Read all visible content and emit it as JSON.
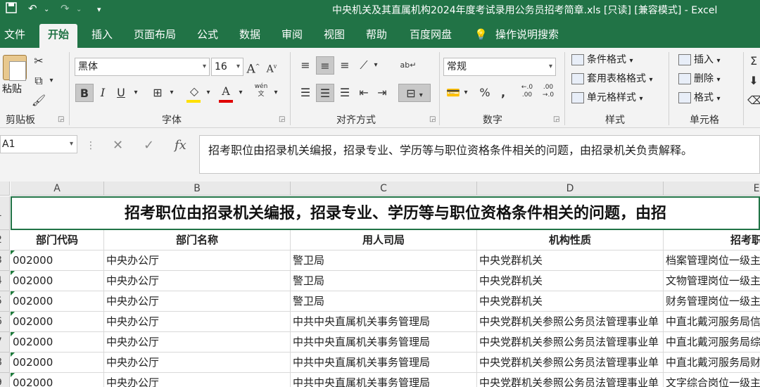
{
  "titlebar": {
    "title": "中央机关及其直属机构2024年度考试录用公务员招考简章.xls  [只读]  [兼容模式]  -  Excel",
    "save_icon": "save-icon",
    "undo_icon": "undo-icon",
    "redo_icon": "redo-icon"
  },
  "tabs": [
    "文件",
    "开始",
    "插入",
    "页面布局",
    "公式",
    "数据",
    "审阅",
    "视图",
    "帮助",
    "百度网盘",
    "操作说明搜索"
  ],
  "ribbon": {
    "clipboard": {
      "paste": "粘贴",
      "label": "剪贴板"
    },
    "font": {
      "name": "黑体",
      "size": "16",
      "label": "字体",
      "bold": "B",
      "italic": "I",
      "underline": "U",
      "grow": "A",
      "shrink": "A",
      "wen": "wén\n文"
    },
    "alignment": {
      "label": "对齐方式"
    },
    "number": {
      "format": "常规",
      "label": "数字",
      "percent": "%",
      "comma": ","
    },
    "styles": {
      "conditional": "条件格式",
      "table": "套用表格格式",
      "cell": "单元格样式",
      "label": "样式"
    },
    "cells": {
      "insert": "插入",
      "delete": "删除",
      "format": "格式",
      "label": "单元格"
    }
  },
  "formula_bar": {
    "name_box": "A1",
    "content": "招考职位由招录机关编报，招录专业、学历等与职位资格条件相关的问题，由招录机关负责解释。"
  },
  "sheet": {
    "columns": [
      "A",
      "B",
      "C",
      "D",
      "E"
    ],
    "row_numbers": [
      "1",
      "2",
      "3",
      "4",
      "5",
      "6",
      "7",
      "8",
      "9"
    ],
    "banner": "招考职位由招录机关编报，招录专业、学历等与职位资格条件相关的问题，由招",
    "headers": [
      "部门代码",
      "部门名称",
      "用人司局",
      "机构性质",
      "招考职"
    ],
    "rows": [
      [
        "002000",
        "中央办公厅",
        "警卫局",
        "中央党群机关",
        "档案管理岗位一级主"
      ],
      [
        "002000",
        "中央办公厅",
        "警卫局",
        "中央党群机关",
        "文物管理岗位一级主"
      ],
      [
        "002000",
        "中央办公厅",
        "警卫局",
        "中央党群机关",
        "财务管理岗位一级主"
      ],
      [
        "002000",
        "中央办公厅",
        "中共中央直属机关事务管理局",
        "中央党群机关参照公务员法管理事业单",
        "中直北戴河服务局信"
      ],
      [
        "002000",
        "中央办公厅",
        "中共中央直属机关事务管理局",
        "中央党群机关参照公务员法管理事业单",
        "中直北戴河服务局综"
      ],
      [
        "002000",
        "中央办公厅",
        "中共中央直属机关事务管理局",
        "中央党群机关参照公务员法管理事业单",
        "中直北戴河服务局财"
      ],
      [
        "002000",
        "中央办公厅",
        "中共中央直属机关事务管理局",
        "中央党群机关参照公务员法管理事业单",
        "文字综合岗位一级主"
      ]
    ]
  }
}
